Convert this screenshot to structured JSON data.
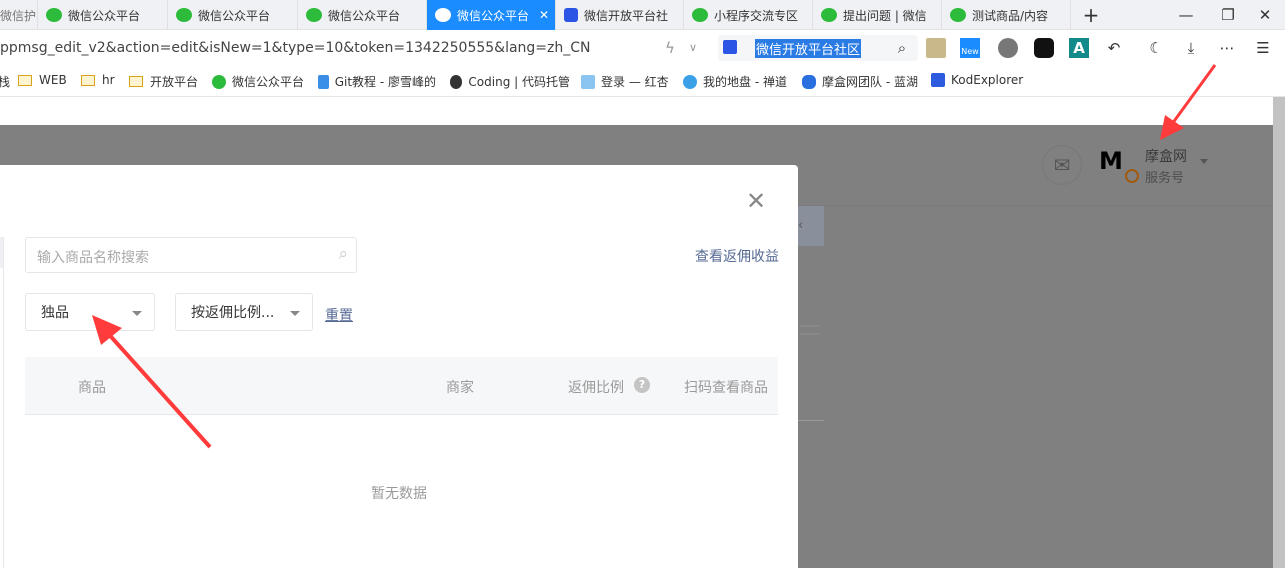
{
  "browser": {
    "tabs": [
      {
        "label": "微信护",
        "icon": "wechat-icon"
      },
      {
        "label": "微信公众平台",
        "icon": "wechat-icon"
      },
      {
        "label": "微信公众平台",
        "icon": "wechat-icon"
      },
      {
        "label": "微信公众平台",
        "icon": "wechat-icon"
      },
      {
        "label": "微信公众平台",
        "icon": "wechat-icon",
        "active": true
      },
      {
        "label": "微信开放平台社",
        "icon": "baidu-paw-icon"
      },
      {
        "label": "小程序交流专区",
        "icon": "wechat-icon"
      },
      {
        "label": "提出问题 | 微信",
        "icon": "wechat-icon"
      },
      {
        "label": "测试商品/内容",
        "icon": "wechat-icon"
      }
    ],
    "url": "ppmsg_edit_v2&action=edit&isNew=1&type=10&token=1342250555&lang=zh_CN",
    "search_value": "微信开放平台社区",
    "bookmarks": [
      {
        "label": "栈",
        "icon": "none"
      },
      {
        "label": "WEB",
        "icon": "folder-icon"
      },
      {
        "label": "hr",
        "icon": "folder-icon"
      },
      {
        "label": "开放平台",
        "icon": "folder-icon"
      },
      {
        "label": "微信公众平台",
        "icon": "wechat-icon"
      },
      {
        "label": "Git教程 - 廖雪峰的",
        "icon": "rocket-icon"
      },
      {
        "label": "Coding | 代码托管",
        "icon": "coding-icon"
      },
      {
        "label": "登录 — 红杏",
        "icon": "rocket-icon"
      },
      {
        "label": "我的地盘 - 禅道",
        "icon": "zentao-icon"
      },
      {
        "label": "摩盒网团队 - 蓝湖",
        "icon": "lanhu-icon"
      },
      {
        "label": "KodExplorer",
        "icon": "kod-icon"
      }
    ]
  },
  "account": {
    "name": "摩盒网",
    "type": "服务号"
  },
  "modal": {
    "search_placeholder": "输入商品名称搜索",
    "earnings_link": "查看返佣收益",
    "filter_type": "独品",
    "sort_by": "按返佣比例...",
    "reset": "重置",
    "columns": [
      "商品",
      "商家",
      "返佣比例",
      "扫码查看商品"
    ],
    "empty_text": "暂无数据"
  },
  "colors": {
    "accent": "#1a8cff",
    "link": "#576b95",
    "annotation_arrow": "#ff3b3b"
  }
}
